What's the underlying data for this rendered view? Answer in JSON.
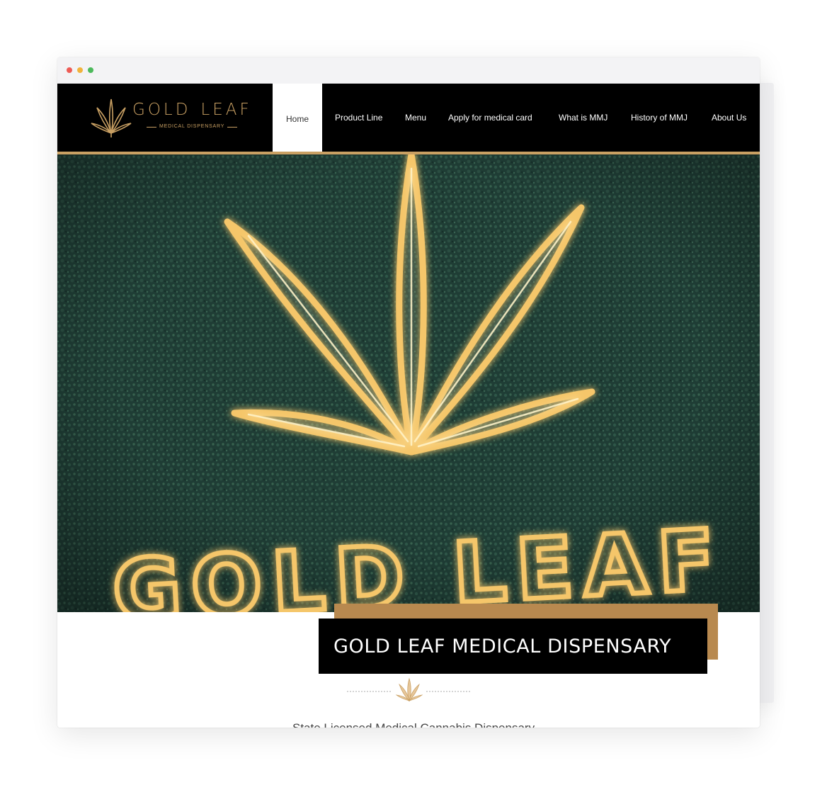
{
  "colors": {
    "gold": "#c9a063",
    "banner_gold": "#b8894f",
    "hero_green": "#1e3c34",
    "dot_red": "#ee5b55",
    "dot_yellow": "#f1b33c",
    "dot_green": "#4cb95b"
  },
  "browser": {
    "controls": [
      "close-dot",
      "minimize-dot",
      "maximize-dot"
    ]
  },
  "logo": {
    "word1": "GOLD",
    "word2": "LEAF",
    "subtitle": "MEDICAL DISPENSARY",
    "icon": "cannabis-leaf-icon"
  },
  "nav": {
    "items": [
      {
        "label": "Home",
        "active": true
      },
      {
        "label": "Product Line"
      },
      {
        "label": "Menu"
      },
      {
        "label": "Apply for medical card"
      },
      {
        "label": "What is MMJ"
      },
      {
        "label": "History of MMJ"
      },
      {
        "label": "About Us"
      }
    ]
  },
  "hero": {
    "text": "GOLD LEAF",
    "icon": "glowing-cannabis-leaf"
  },
  "banner": {
    "title": "GOLD LEAF MEDICAL DISPENSARY"
  },
  "intro": {
    "text": "State Licensed Medical Cannabis Dispensary"
  }
}
